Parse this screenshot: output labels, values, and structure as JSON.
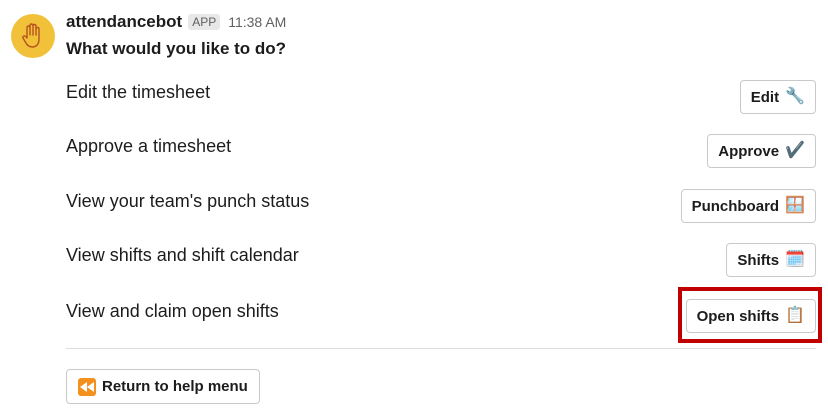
{
  "message": {
    "bot_name": "attendancebot",
    "badge": "APP",
    "timestamp": "11:38 AM",
    "question": "What would you like to do?"
  },
  "actions": [
    {
      "label": "Edit the timesheet",
      "button": "Edit",
      "emoji": "🔧"
    },
    {
      "label": "Approve a timesheet",
      "button": "Approve",
      "emoji": "✔️"
    },
    {
      "label": "View your team's punch status",
      "button": "Punchboard",
      "emoji": "🪟"
    },
    {
      "label": "View shifts and shift calendar",
      "button": "Shifts",
      "emoji": "🗓️"
    },
    {
      "label": "View and claim open shifts",
      "button": "Open shifts",
      "emoji": "📋"
    }
  ],
  "footer": {
    "help_button": "Return to help menu",
    "help_icon": "rewind-icon"
  },
  "avatar_icon": "raised-hand-icon",
  "colors": {
    "avatar_bg": "#f2c13a",
    "highlight": "#c00000",
    "rewind": "#f3901e"
  }
}
